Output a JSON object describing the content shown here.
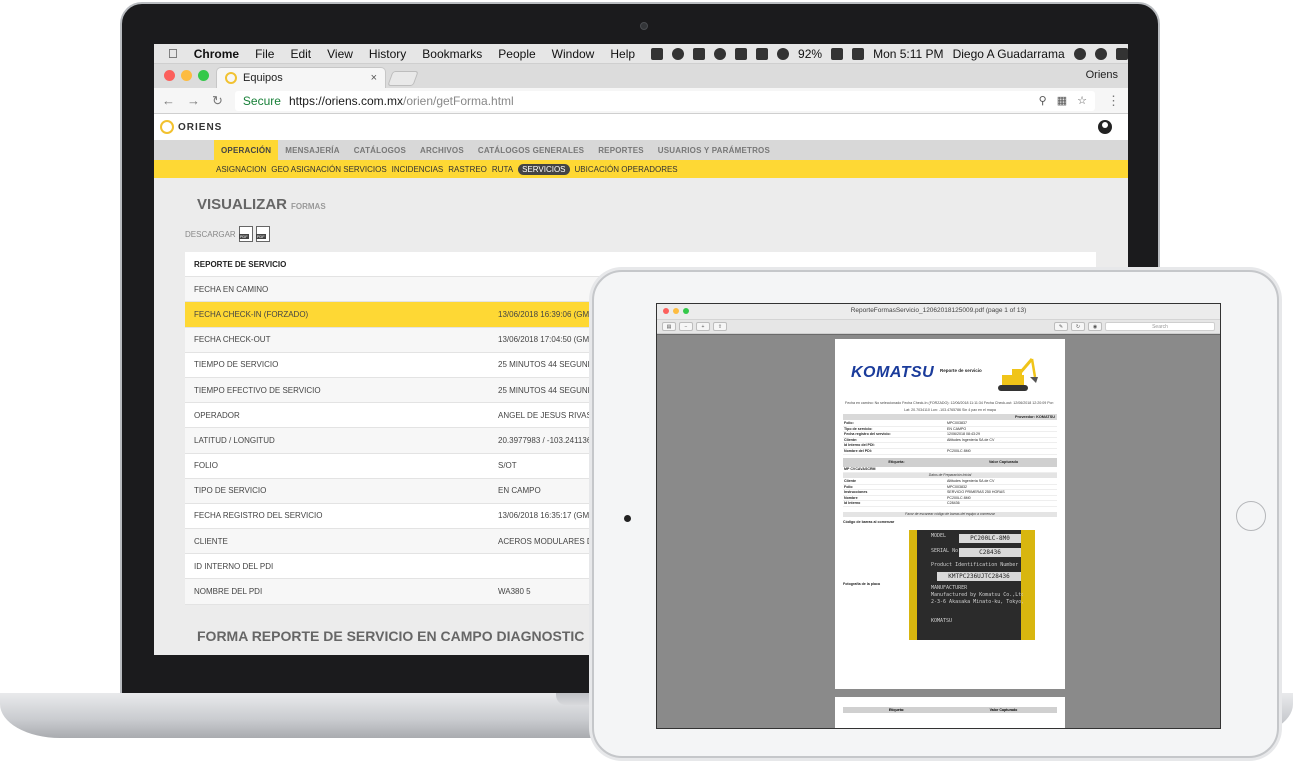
{
  "menubar": {
    "items": [
      "Chrome",
      "File",
      "Edit",
      "View",
      "History",
      "Bookmarks",
      "People",
      "Window",
      "Help"
    ],
    "battery": "92%",
    "clock": "Mon 5:11 PM",
    "user": "Diego A Guadarrama"
  },
  "browser": {
    "tab_title": "Equipos",
    "tab_close": "×",
    "profile": "Oriens",
    "secure_label": "Secure",
    "url_host": "https://oriens.com.mx",
    "url_path": "/orien/getForma.html"
  },
  "app": {
    "logo_text": "ORIENS",
    "main_nav": [
      "OPERACIÓN",
      "MENSAJERÍA",
      "CATÁLOGOS",
      "ARCHIVOS",
      "CATÁLOGOS GENERALES",
      "REPORTES",
      "USUARIOS Y PARÁMETROS"
    ],
    "sub_nav": [
      "ASIGNACION",
      "GEO ASIGNACIÓN SERVICIOS",
      "INCIDENCIAS",
      "RASTREO",
      "RUTA",
      "SERVICIOS",
      "UBICACIÓN OPERADORES"
    ],
    "page_title": "VISUALIZAR",
    "page_subtitle": "FORMAS",
    "download_label": "DESCARGAR",
    "pdf_label": "PDF",
    "table_header": "REPORTE DE SERVICIO",
    "rows": [
      {
        "label": "FECHA EN CAMINO",
        "value": ""
      },
      {
        "label": "FECHA CHECK-IN (FORZADO)",
        "value": "13/06/2018 16:39:06 (GMT -"
      },
      {
        "label": "FECHA CHECK-OUT",
        "value": "13/06/2018 17:04:50 (GMT -"
      },
      {
        "label": "TIEMPO DE SERVICIO",
        "value": "25 MINUTOS 44 SEGUNDO"
      },
      {
        "label": "TIEMPO EFECTIVO DE SERVICIO",
        "value": "25 MINUTOS 44 SEGUNDO"
      },
      {
        "label": "OPERADOR",
        "value": "ANGEL DE JESUS RIVAS"
      },
      {
        "label": "LATITUD / LONGITUD",
        "value": "20.3977983 / -103.2411363"
      },
      {
        "label": "FOLIO",
        "value": "S/OT"
      },
      {
        "label": "TIPO DE SERVICIO",
        "value": "EN CAMPO"
      },
      {
        "label": "FECHA REGISTRO DEL SERVICIO",
        "value": "13/06/2018 16:35:17 (GMT -"
      },
      {
        "label": "CLIENTE",
        "value": "ACEROS MODULARES D"
      },
      {
        "label": "ID INTERNO DEL PDI",
        "value": ""
      },
      {
        "label": "NOMBRE DEL PDI",
        "value": "WA380 5"
      }
    ],
    "form_title": "FORMA REPORTE DE SERVICIO EN CAMPO DIAGNOSTIC"
  },
  "preview": {
    "title": "ReporteFormasServicio_12062018125009.pdf (page 1 of 13)",
    "search_placeholder": "Search",
    "brand": "KOMATSU",
    "report_title": "Reporte de servicio",
    "meta_line1": "Fecha en camino: No seleccionado Fecha Check-In (FORZADO): 12/06/2018 11:11:34 Fecha Check-out: 12/06/2018 12:20:09 Por: Víctor Riosgua",
    "meta_line2": "Lat: 20.7034110 Lon: -103.4765786 Sin 4 pax en el mapa",
    "provider": "Proveedor: KOMATSU",
    "rows1": [
      {
        "label": "Folio:",
        "value": "MPC003837"
      },
      {
        "label": "Tipo de servicio:",
        "value": "EN CAMPO"
      },
      {
        "label": "Fecha registro del servicio:",
        "value": "12/06/2018 08:43:29"
      },
      {
        "label": "Cliente:",
        "value": "Altitudes Ingeniería SA de CV"
      },
      {
        "label": "Id Interno del PDI:",
        "value": ""
      },
      {
        "label": "Nombre del PDI:",
        "value": "PC200LC 8M0"
      }
    ],
    "col_label": "Etiqueta:",
    "col_value": "Valor Capturado",
    "mp_label": "MP CVCAVASCRM",
    "subband": "Datos de Preparación Inicial",
    "rows2": [
      {
        "label": "Cliente",
        "value": "Altitudes Ingeniería SA de CV"
      },
      {
        "label": "Folio",
        "value": "MPC003832"
      },
      {
        "label": "Instrucciones",
        "value": "SERVICIO PRIMERAS 250 HORAS"
      },
      {
        "label": "Nombre",
        "value": "PC200LC 8M0"
      },
      {
        "label": "Id Interno",
        "value": "C28436"
      }
    ],
    "scan_note": "Favor de escanear código de barras del equipo a comenzar",
    "barcode_label": "Código de barras al comenzar",
    "photo_label": "Fotografía de la placa",
    "plate_model": "PC200LC-8M0",
    "plate_serial": "C28436",
    "plate_lines": [
      "MODEL",
      "SERIAL No.",
      "Product Identification Number",
      "KMTPC236UJTC28436",
      "MANUFACTURER",
      "Manufactured by Komatsu Co.,Ltd.",
      "2-3-6 Akasaka Minato-ku, Tokyo, Japan"
    ],
    "plate_brand": "KOMATSU"
  }
}
